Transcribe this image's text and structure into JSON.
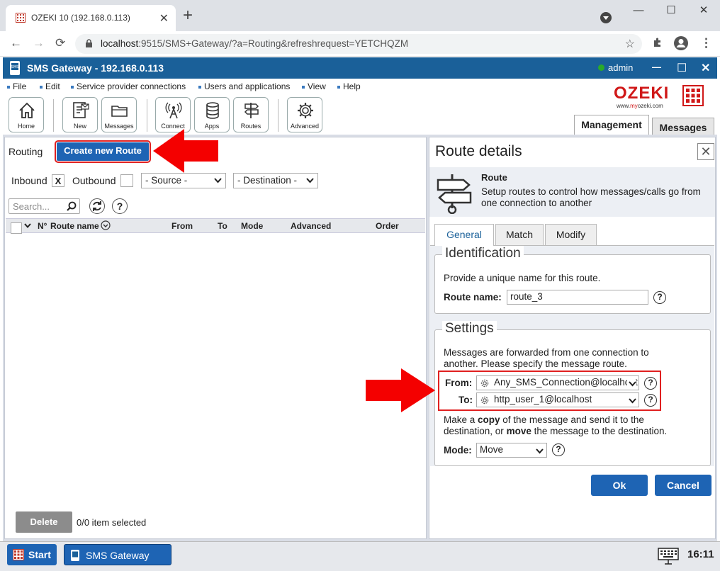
{
  "browser": {
    "tab_title": "OZEKI 10 (192.168.0.113)",
    "url_host": "localhost",
    "url_rest": ":9515/SMS+Gateway/?a=Routing&refreshrequest=YETCHQZM"
  },
  "app": {
    "title": "SMS Gateway - 192.168.0.113",
    "user": "admin",
    "menu": [
      "File",
      "Edit",
      "Service provider connections",
      "Users and applications",
      "View",
      "Help"
    ],
    "toolbar": [
      "Home",
      "New",
      "Messages",
      "Connect",
      "Apps",
      "Routes",
      "Advanced"
    ],
    "logo_text": "OZEKI",
    "logo_url_pre": "www.",
    "logo_url_my": "my",
    "logo_url_post": "ozeki.com",
    "tabs": [
      "Management",
      "Messages"
    ]
  },
  "routing": {
    "label": "Routing",
    "create_button": "Create new Route",
    "inbound_label": "Inbound",
    "inbound_mark": "X",
    "outbound_label": "Outbound",
    "source_select": "- Source -",
    "destination_select": "- Destination -",
    "search_placeholder": "Search...",
    "columns": [
      "N°",
      "Route name",
      "From",
      "To",
      "Mode",
      "Advanced",
      "Order"
    ],
    "delete_button": "Delete",
    "selection_count": "0/0 item selected"
  },
  "details": {
    "title": "Route details",
    "header_title": "Route",
    "header_desc": "Setup routes to control how messages/calls go from one connection to another",
    "tabs": [
      "General",
      "Match",
      "Modify"
    ],
    "identification": {
      "legend": "Identification",
      "desc": "Provide a unique name for this route.",
      "name_label": "Route name:",
      "name_value": "route_3"
    },
    "settings": {
      "legend": "Settings",
      "desc": "Messages are forwarded from one connection to another. Please specify the message route.",
      "from_label": "From:",
      "from_value": "Any_SMS_Connection@localhost",
      "to_label": "To:",
      "to_value": "http_user_1@localhost",
      "copy_desc_1": "Make a ",
      "copy_word": "copy",
      "copy_desc_2": " of the message and send it to the destination, or ",
      "move_word": "move",
      "copy_desc_3": " the message to the destination.",
      "mode_label": "Mode:",
      "mode_value": "Move"
    },
    "ok_button": "Ok",
    "cancel_button": "Cancel"
  },
  "taskbar": {
    "start": "Start",
    "app": "SMS Gateway",
    "time": "16:11"
  },
  "colors": {
    "header_blue": "#1a6099",
    "button_blue": "#1e64b4",
    "highlight_red": "#e02020"
  }
}
